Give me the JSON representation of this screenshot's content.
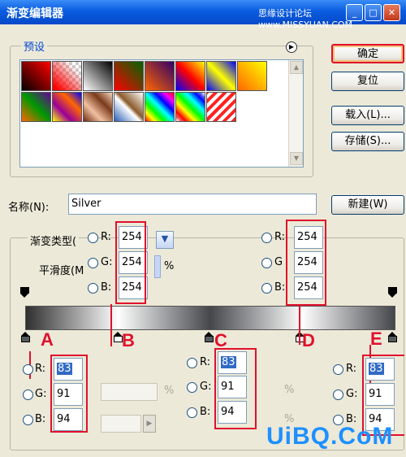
{
  "window": {
    "title": "渐变编辑器",
    "watermark_top": "思缘设计论坛 www.MISSYUAN.COM",
    "minimize_glyph": "_",
    "maximize_glyph": "□",
    "close_glyph": "✕"
  },
  "presets": {
    "title": "预设",
    "menu_icon": "circle-arrow-right-icon",
    "swatches_row1": [
      "red-black",
      "red-transparent",
      "black-white",
      "red-green",
      "violet-orange",
      "blue-red-yellow",
      "blue-yellow-blue",
      "orange-yellow"
    ],
    "swatches_row2": [
      "violet-green-orange",
      "yellow-violet-orange-blue",
      "copper",
      "chrome",
      "spectrum",
      "transparent-rainbow",
      "transparent-stripes"
    ]
  },
  "buttons": {
    "ok": "确定",
    "reset": "复位",
    "load": "载入(L)...",
    "save": "存储(S)...",
    "new": "新建(W)"
  },
  "name_field": {
    "label": "名称(N):",
    "value": "Silver"
  },
  "gradient": {
    "type_label": "渐变类型(",
    "smooth_label": "平滑度(M",
    "smooth_unit": "%",
    "colors": {
      "top_left": "#2f2f2f",
      "dark": "#45474b",
      "mid": "#8a8c90",
      "light": "#fefefe"
    }
  },
  "top_left_color": {
    "r": "254",
    "g": "254",
    "b": "254",
    "r_label": "R:",
    "g_label": "G:",
    "b_label": "B:"
  },
  "top_right_color": {
    "r": "254",
    "g": "254",
    "b": "254",
    "r_label": "R:",
    "g_label": "G",
    "b_label": "B:"
  },
  "stop_a": {
    "letter": "A",
    "r": "83",
    "g": "91",
    "b": "94",
    "r_label": "R:",
    "g_label": "G:",
    "b_label": "B:"
  },
  "stop_b": {
    "letter": "B"
  },
  "stop_c": {
    "letter": "C",
    "r": "83",
    "g": "91",
    "b": "94",
    "r_label": "R:",
    "g_label": "G:",
    "b_label": "B:"
  },
  "stop_d": {
    "letter": "D"
  },
  "stop_e": {
    "letter": "E",
    "r": "83",
    "g": "91",
    "b": "94",
    "r_label": "R:",
    "g_label": "G:",
    "b_label": "B:"
  },
  "percent": "%",
  "watermark_bottom": "UiBQ.CoM",
  "accent": "#e0102c"
}
